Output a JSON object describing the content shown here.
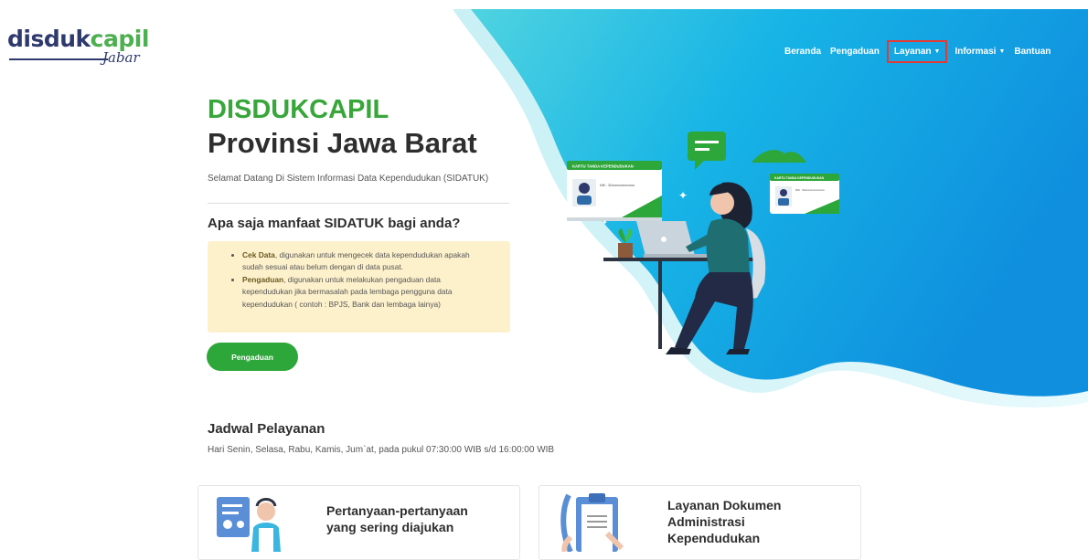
{
  "logo": {
    "main_dark": "disduk",
    "main_accent": "capil",
    "script": "Jabar"
  },
  "nav": {
    "items": [
      {
        "label": "Beranda",
        "caret": false
      },
      {
        "label": "Pengaduan",
        "caret": false
      },
      {
        "label": "Layanan",
        "caret": true,
        "highlighted": true
      },
      {
        "label": "Informasi",
        "caret": true
      },
      {
        "label": "Bantuan",
        "caret": false
      }
    ]
  },
  "hero": {
    "title_line1": "DISDUKCAPIL",
    "title_line2": "Provinsi Jawa Barat",
    "welcome": "Selamat Datang Di Sistem Informasi Data Kependudukan (SIDATUK)",
    "question": "Apa saja manfaat SIDATUK bagi anda?",
    "benefits": [
      {
        "term": "Cek Data",
        "text": ", digunakan untuk mengecek data kependudukan apakah sudah sesuai atau belum dengan di data pusat."
      },
      {
        "term": "Pengaduan",
        "text": ", digunakan untuk melakukan pengaduan data kependudukan jika bermasalah pada lembaga pengguna data kependudukan ( contoh : BPJS, Bank dan lembaga lainya)"
      }
    ],
    "button_label": "Pengaduan"
  },
  "illustration": {
    "card_big_title": "KARTU TANDA KEPENDUDUKAN",
    "card_big_nik": "NIK : 32xxxxxxxxxxxxxx",
    "card_small_title": "KARTU TANDA KEPENDUDUKAN",
    "card_small_nik": "NIK : 32xxxxxxxxxxxxxx"
  },
  "schedule": {
    "title": "Jadwal Pelayanan",
    "text": "Hari Senin, Selasa, Rabu, Kamis, Jum`at, pada pukul 07:30:00 WIB s/d 16:00:00 WIB"
  },
  "cards": [
    {
      "title": "Pertanyaan-pertanyaan yang sering diajukan"
    },
    {
      "title": "Layanan Dokumen Administrasi Kependudukan"
    }
  ],
  "colors": {
    "brand_green": "#2da63a",
    "hero_blue": "#1fb6e6",
    "nav_highlight": "#e53935",
    "info_bg": "#fdf1cc"
  }
}
